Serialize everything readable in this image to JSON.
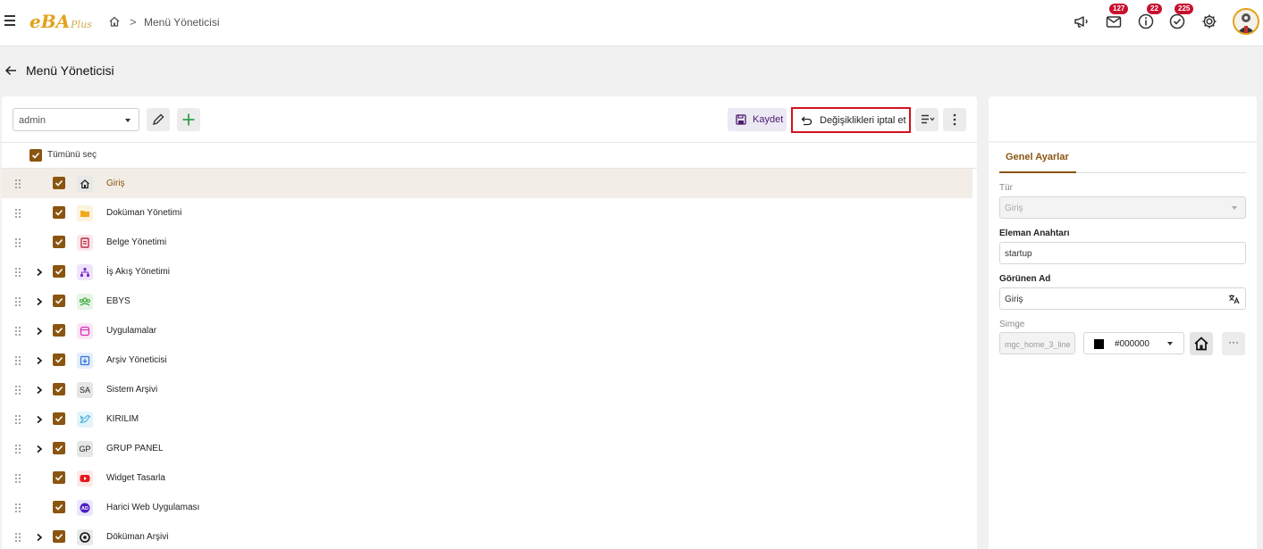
{
  "topbar": {
    "logo_main": "eBA",
    "logo_sub": "Plus",
    "breadcrumb": "Menü Yöneticisi",
    "badges": {
      "mail": "127",
      "info": "22",
      "tasks": "225"
    }
  },
  "page": {
    "title": "Menü Yöneticisi"
  },
  "toolbar": {
    "user_select": "admin",
    "save_label": "Kaydet",
    "cancel_label": "Değişiklikleri iptal et"
  },
  "tree": {
    "select_all_label": "Tümünü seç",
    "items": [
      {
        "label": "Giriş",
        "icon": "home-icon",
        "expandable": false,
        "selected": true
      },
      {
        "label": "Doküman Yönetimi",
        "icon": "folder-icon",
        "expandable": false
      },
      {
        "label": "Belge Yönetimi",
        "icon": "document-icon",
        "expandable": false
      },
      {
        "label": "İş Akış Yönetimi",
        "icon": "workflow-icon",
        "expandable": true
      },
      {
        "label": "EBYS",
        "icon": "group-icon",
        "expandable": true
      },
      {
        "label": "Uygulamalar",
        "icon": "app-icon",
        "expandable": true
      },
      {
        "label": "Arşiv Yöneticisi",
        "icon": "archive-icon",
        "expandable": true
      },
      {
        "label": "Sistem Arşivi",
        "icon": "text-badge",
        "badge": "SA",
        "expandable": true
      },
      {
        "label": "KIRILIM",
        "icon": "bird-icon",
        "expandable": true
      },
      {
        "label": "GRUP PANEL",
        "icon": "text-badge",
        "badge": "GP",
        "expandable": true
      },
      {
        "label": "Widget Tasarla",
        "icon": "youtube-icon",
        "expandable": false
      },
      {
        "label": "Harici Web Uygulaması",
        "icon": "ad-icon",
        "expandable": false
      },
      {
        "label": "Döküman Arşivi",
        "icon": "target-icon",
        "expandable": true
      }
    ]
  },
  "settings": {
    "tab_label": "Genel Ayarlar",
    "type_label": "Tür",
    "type_value": "Giriş",
    "key_label": "Eleman Anahtarı",
    "key_value": "startup",
    "display_label": "Görünen Ad",
    "display_value": "Giriş",
    "icon_label": "Simge",
    "icon_value": "mgc_home_3_line",
    "color_value": "#000000"
  },
  "colors": {
    "accent": "#8a5510",
    "highlight": "#d4121f",
    "badge": "#c8102e"
  }
}
